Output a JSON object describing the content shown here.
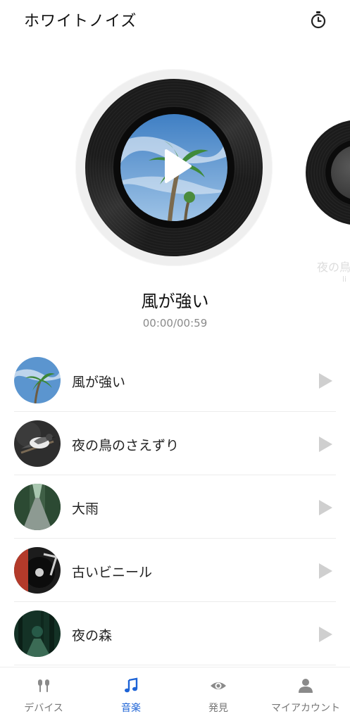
{
  "header": {
    "title": "ホワイトノイズ",
    "timer_icon": "stopwatch-icon"
  },
  "now_playing": {
    "title": "風が強い",
    "time": "00:00/00:59"
  },
  "next_record": {
    "title": "夜の鳥",
    "subtitle": "li"
  },
  "tracks": [
    {
      "name": "風が強い",
      "thumb": "palm-sky"
    },
    {
      "name": "夜の鳥のさえずり",
      "thumb": "bird"
    },
    {
      "name": "大雨",
      "thumb": "forest-road"
    },
    {
      "name": "古いビニール",
      "thumb": "vinyl-player"
    },
    {
      "name": "夜の森",
      "thumb": "night-forest"
    }
  ],
  "nav": [
    {
      "label": "デバイス",
      "icon": "earbuds-icon",
      "active": false
    },
    {
      "label": "音楽",
      "icon": "music-note-icon",
      "active": true
    },
    {
      "label": "発見",
      "icon": "eye-icon",
      "active": false
    },
    {
      "label": "マイアカウント",
      "icon": "person-icon",
      "active": false
    }
  ],
  "colors": {
    "accent": "#1d63d6",
    "text": "#111111",
    "muted": "#8a8a8a",
    "play_gray": "#cfcfcf"
  }
}
